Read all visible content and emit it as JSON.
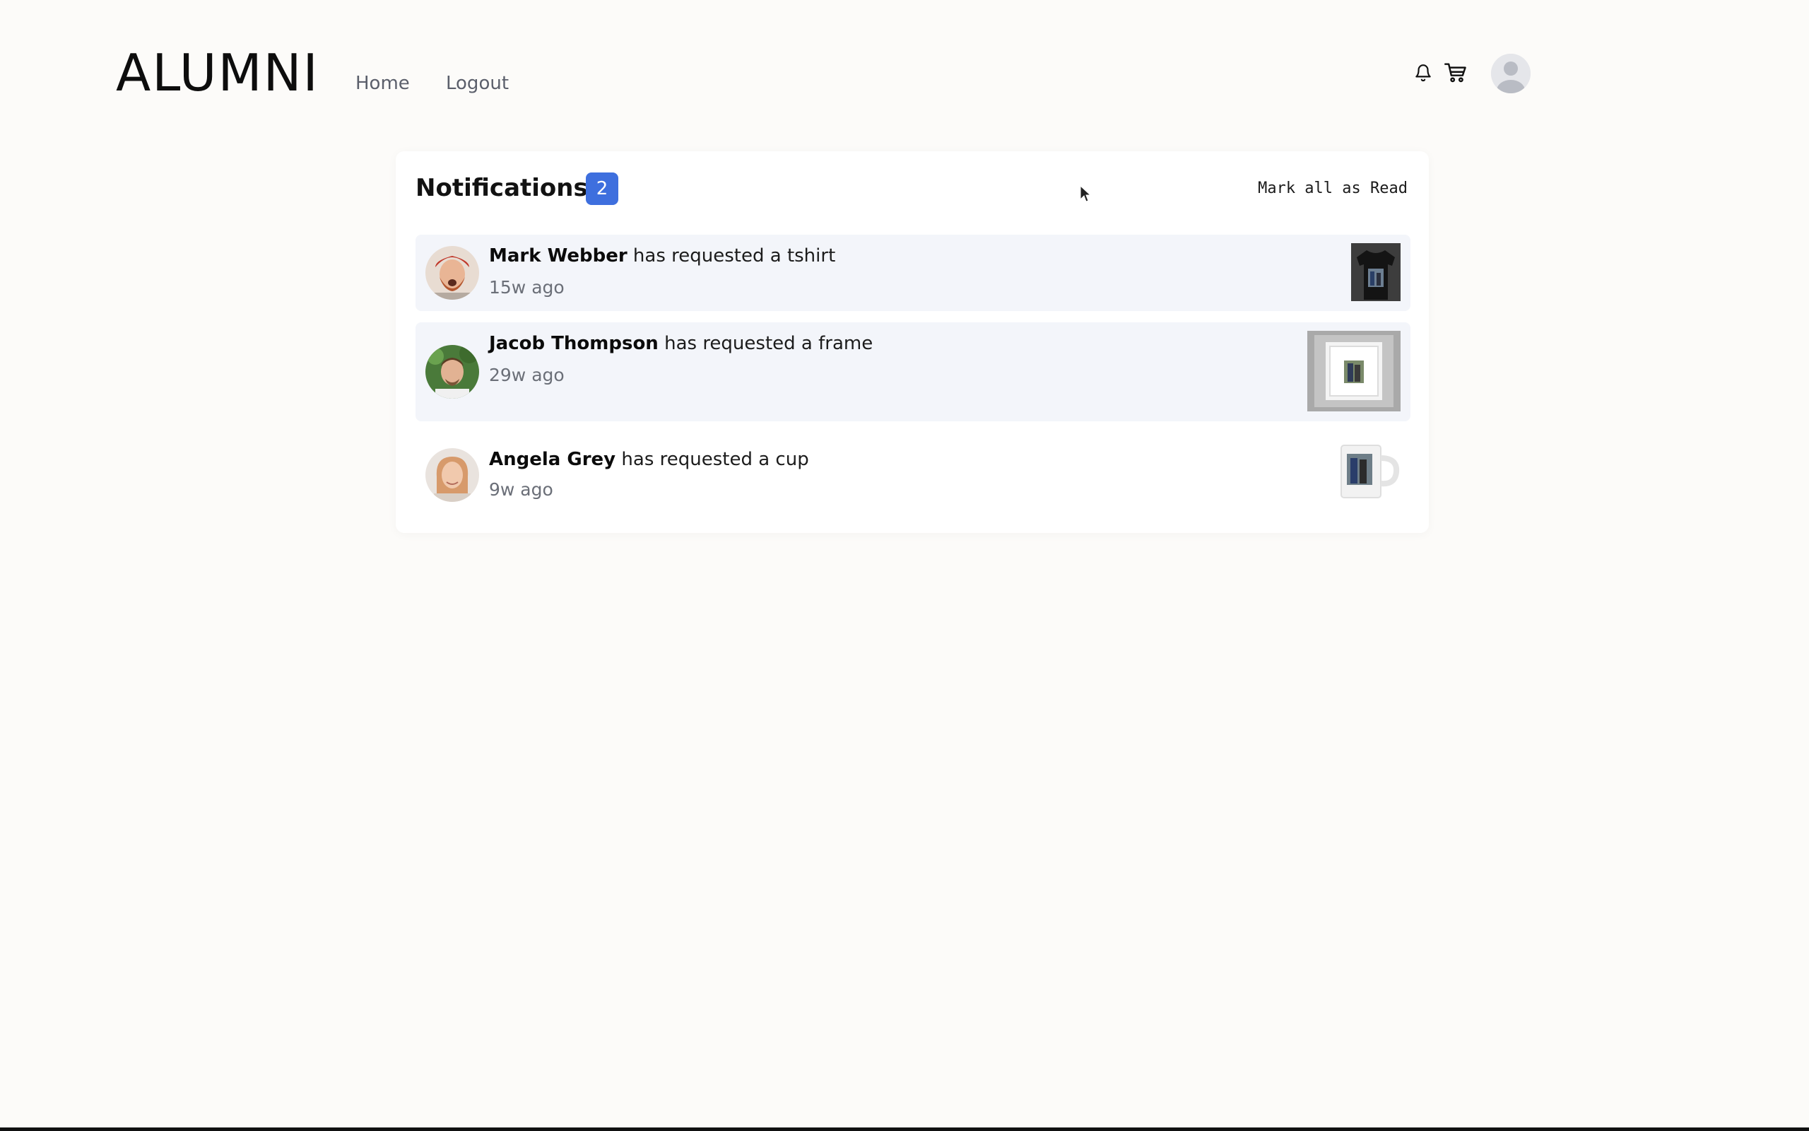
{
  "header": {
    "logo": "ALUMNI",
    "nav": [
      {
        "label": "Home"
      },
      {
        "label": "Logout"
      }
    ],
    "icons": [
      "bell-icon",
      "cart-icon",
      "user-avatar-icon"
    ]
  },
  "notifications": {
    "title": "Notifications",
    "unread_count": "2",
    "mark_all_label": "Mark all as Read",
    "items": [
      {
        "name": "Mark Webber",
        "action": " has requested a tshirt",
        "time": "15w ago",
        "unread": true,
        "product": "tshirt"
      },
      {
        "name": "Jacob Thompson",
        "action": " has requested a frame",
        "time": "29w ago",
        "unread": true,
        "product": "frame"
      },
      {
        "name": "Angela Grey",
        "action": " has requested a cup",
        "time": "9w ago",
        "unread": false,
        "product": "cup"
      }
    ]
  },
  "colors": {
    "background": "#fcfbf9",
    "accent": "#3e6fde",
    "unread_row": "#f3f5fa",
    "muted_text": "#6b6f78"
  }
}
